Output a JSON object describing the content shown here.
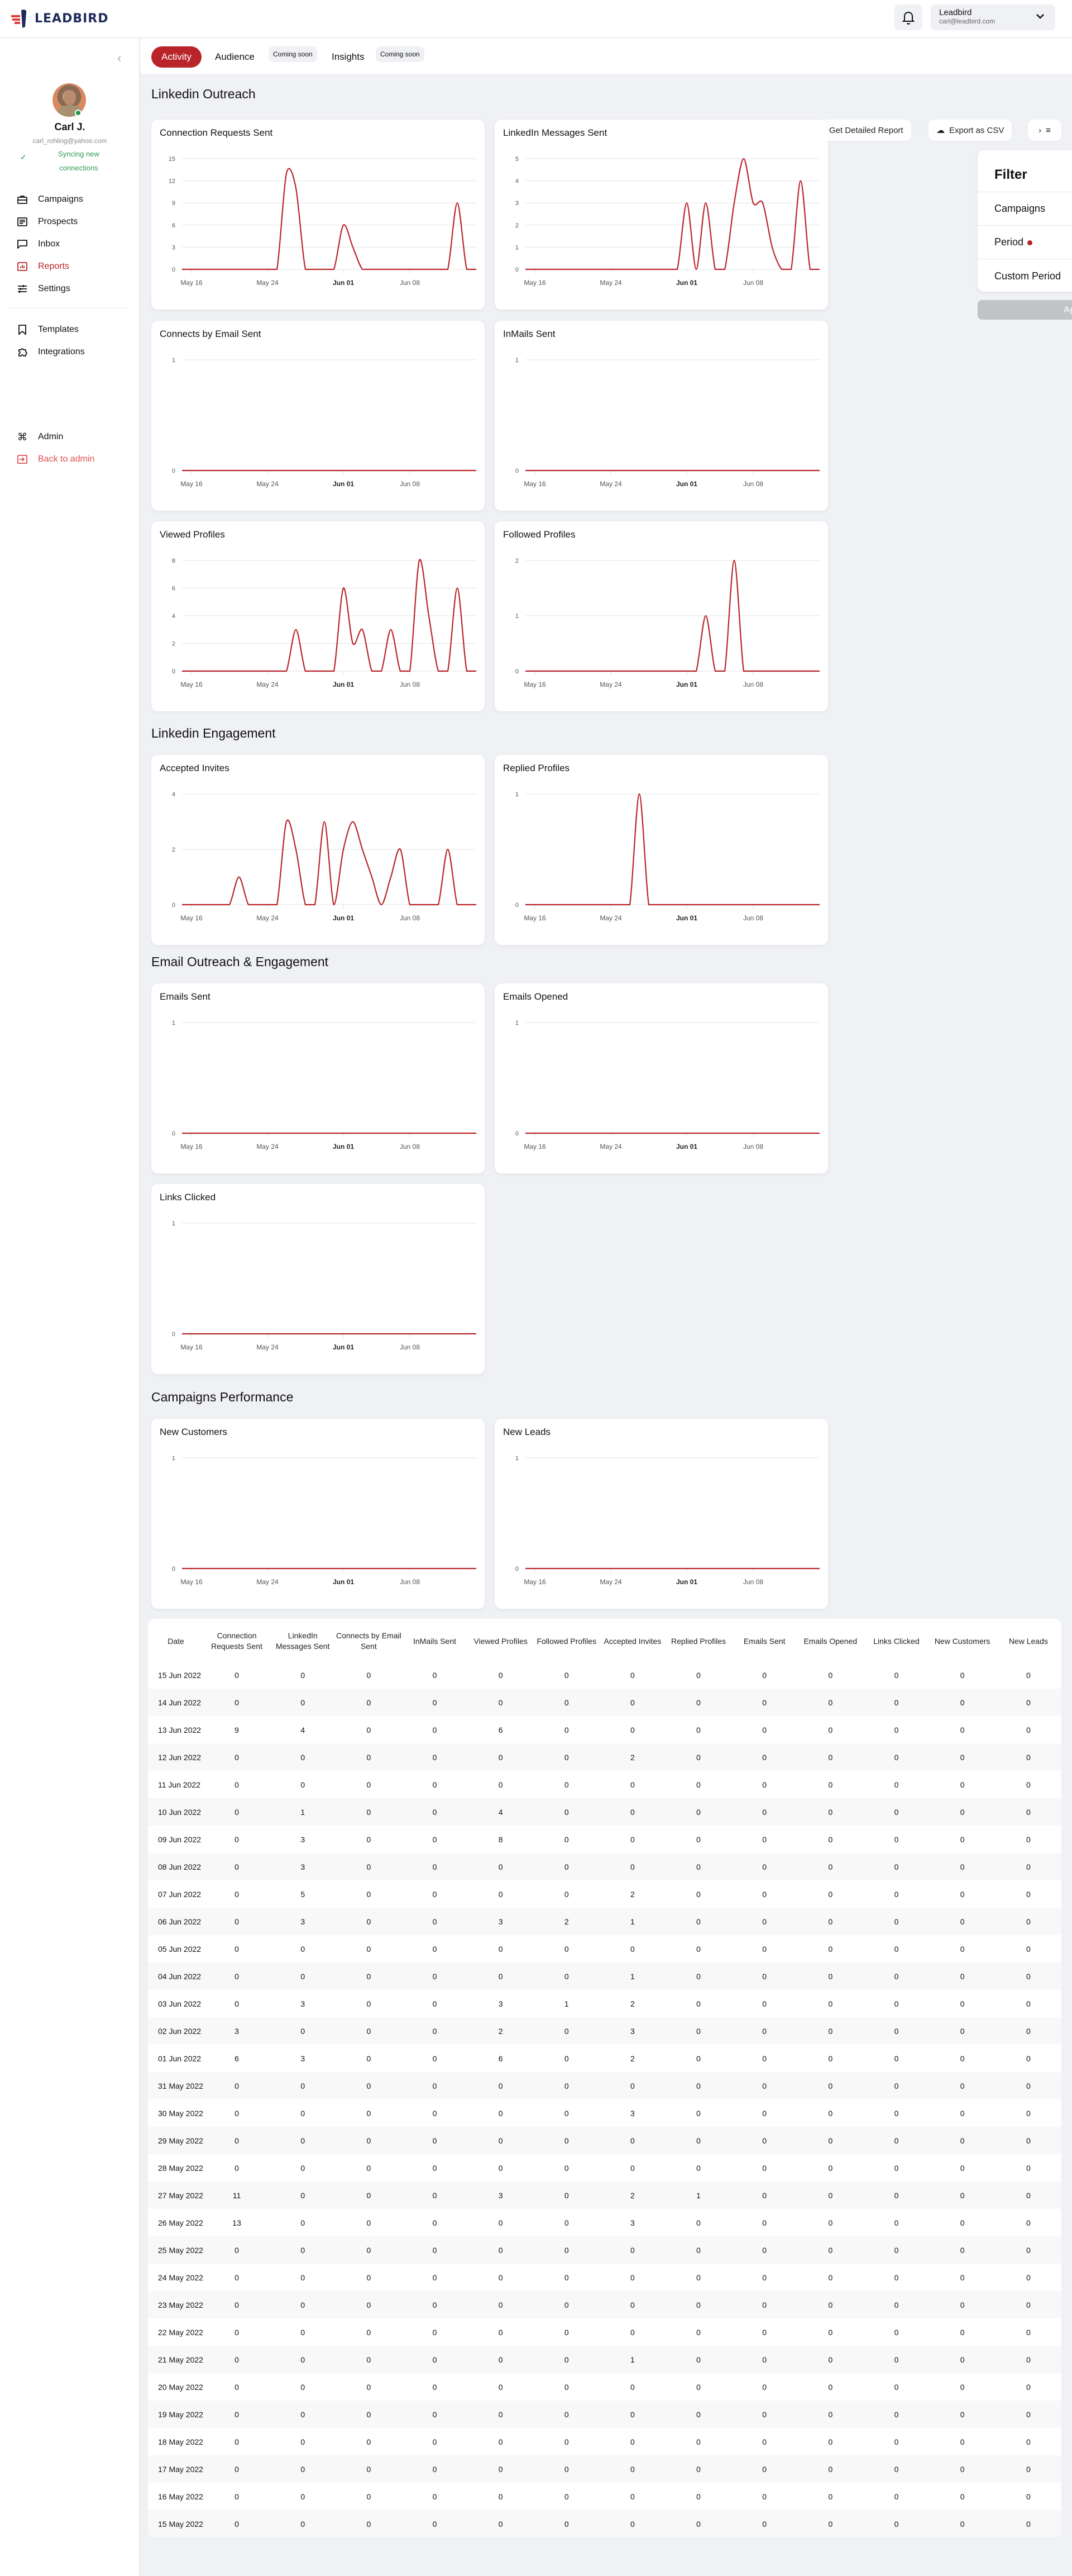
{
  "topbar": {
    "logo_text": "LEADBIRD",
    "account": {
      "name": "Leadbird",
      "email": "carl@leadbird.com"
    }
  },
  "sidebar": {
    "user": {
      "name": "Carl J.",
      "email": "carl_rohling@yahoo.com",
      "sync_status": "Syncing new connections"
    },
    "nav_main": [
      {
        "label": "Campaigns",
        "icon": "briefcase-icon"
      },
      {
        "label": "Prospects",
        "icon": "list-card-icon"
      },
      {
        "label": "Inbox",
        "icon": "chat-bubble-icon"
      },
      {
        "label": "Reports",
        "icon": "bar-chart-icon",
        "active": true
      },
      {
        "label": "Settings",
        "icon": "sliders-icon"
      }
    ],
    "nav_secondary": [
      {
        "label": "Templates",
        "icon": "bookmark-icon"
      },
      {
        "label": "Integrations",
        "icon": "puzzle-icon"
      }
    ],
    "nav_admin": [
      {
        "label": "Admin",
        "icon": "command-icon"
      },
      {
        "label": "Back to admin",
        "icon": "sign-in-icon"
      }
    ]
  },
  "tabs": {
    "activity": "Activity",
    "audience": "Audience",
    "audience_badge": "Coming soon",
    "insights": "Insights",
    "insights_badge": "Coming soon"
  },
  "toolbar": {
    "detailed_report": "Get Detailed Report",
    "export_csv": "Export as CSV",
    "filter_toggle": "›"
  },
  "filter": {
    "title": "Filter",
    "rows": [
      "Campaigns",
      "Period",
      "Custom Period"
    ],
    "apply": "Apply filters"
  },
  "sections": {
    "linkedin_outreach": "Linkedin Outreach",
    "linkedin_engagement": "Linkedin Engagement",
    "email": "Email Outreach & Engagement",
    "campaigns": "Campaigns Performance"
  },
  "colors": {
    "accent": "#b9242a",
    "success": "#1f9a4b",
    "background": "#f0f1f5"
  },
  "chart_data": [
    {
      "type": "line",
      "title": "Connection Requests Sent",
      "x_ticks": [
        "May 16",
        "May 24",
        "Jun 01",
        "Jun 08"
      ],
      "y_ticks": [
        0,
        3,
        6,
        9,
        12,
        15
      ],
      "ylim": [
        0,
        15
      ],
      "x_start": "15 May 2022",
      "values": [
        0,
        0,
        0,
        0,
        0,
        0,
        0,
        0,
        0,
        0,
        0,
        13,
        11,
        0,
        0,
        0,
        0,
        6,
        3,
        0,
        0,
        0,
        0,
        0,
        0,
        0,
        0,
        0,
        0,
        9,
        0,
        0
      ]
    },
    {
      "type": "line",
      "title": "LinkedIn Messages Sent",
      "x_ticks": [
        "May 16",
        "May 24",
        "Jun 01",
        "Jun 08"
      ],
      "y_ticks": [
        0,
        1,
        2,
        3,
        4,
        5
      ],
      "ylim": [
        0,
        5
      ],
      "x_start": "15 May 2022",
      "values": [
        0,
        0,
        0,
        0,
        0,
        0,
        0,
        0,
        0,
        0,
        0,
        0,
        0,
        0,
        0,
        0,
        0,
        3,
        0,
        3,
        0,
        0,
        3,
        5,
        3,
        3,
        1,
        0,
        0,
        4,
        0,
        0
      ]
    },
    {
      "type": "line",
      "title": "Connects by Email Sent",
      "x_ticks": [
        "May 16",
        "May 24",
        "Jun 01",
        "Jun 08"
      ],
      "y_ticks": [
        0,
        1
      ],
      "ylim": [
        0,
        1
      ],
      "x_start": "15 May 2022",
      "values": [
        0,
        0,
        0,
        0,
        0,
        0,
        0,
        0,
        0,
        0,
        0,
        0,
        0,
        0,
        0,
        0,
        0,
        0,
        0,
        0,
        0,
        0,
        0,
        0,
        0,
        0,
        0,
        0,
        0,
        0,
        0,
        0
      ]
    },
    {
      "type": "line",
      "title": "InMails Sent",
      "x_ticks": [
        "May 16",
        "May 24",
        "Jun 01",
        "Jun 08"
      ],
      "y_ticks": [
        0,
        1
      ],
      "ylim": [
        0,
        1
      ],
      "x_start": "15 May 2022",
      "values": [
        0,
        0,
        0,
        0,
        0,
        0,
        0,
        0,
        0,
        0,
        0,
        0,
        0,
        0,
        0,
        0,
        0,
        0,
        0,
        0,
        0,
        0,
        0,
        0,
        0,
        0,
        0,
        0,
        0,
        0,
        0,
        0
      ]
    },
    {
      "type": "line",
      "title": "Viewed Profiles",
      "x_ticks": [
        "May 16",
        "May 24",
        "Jun 01",
        "Jun 08"
      ],
      "y_ticks": [
        0,
        2,
        4,
        6,
        8
      ],
      "ylim": [
        0,
        8
      ],
      "x_start": "15 May 2022",
      "values": [
        0,
        0,
        0,
        0,
        0,
        0,
        0,
        0,
        0,
        0,
        0,
        0,
        3,
        0,
        0,
        0,
        0,
        6,
        2,
        3,
        0,
        0,
        3,
        0,
        0,
        8,
        4,
        0,
        0,
        6,
        0,
        0
      ]
    },
    {
      "type": "line",
      "title": "Followed Profiles",
      "x_ticks": [
        "May 16",
        "May 24",
        "Jun 01",
        "Jun 08"
      ],
      "y_ticks": [
        0,
        1,
        2
      ],
      "ylim": [
        0,
        2
      ],
      "x_start": "15 May 2022",
      "values": [
        0,
        0,
        0,
        0,
        0,
        0,
        0,
        0,
        0,
        0,
        0,
        0,
        0,
        0,
        0,
        0,
        0,
        0,
        0,
        1,
        0,
        0,
        2,
        0,
        0,
        0,
        0,
        0,
        0,
        0,
        0,
        0
      ]
    },
    {
      "type": "line",
      "title": "Accepted Invites",
      "x_ticks": [
        "May 16",
        "May 24",
        "Jun 01",
        "Jun 08"
      ],
      "y_ticks": [
        0,
        2,
        4
      ],
      "ylim": [
        0,
        4
      ],
      "x_start": "15 May 2022",
      "values": [
        0,
        0,
        0,
        0,
        0,
        0,
        1,
        0,
        0,
        0,
        0,
        3,
        2,
        0,
        0,
        3,
        0,
        2,
        3,
        2,
        1,
        0,
        1,
        2,
        0,
        0,
        0,
        0,
        2,
        0,
        0,
        0
      ]
    },
    {
      "type": "line",
      "title": "Replied Profiles",
      "x_ticks": [
        "May 16",
        "May 24",
        "Jun 01",
        "Jun 08"
      ],
      "y_ticks": [
        0,
        1
      ],
      "ylim": [
        0,
        1
      ],
      "x_start": "15 May 2022",
      "values": [
        0,
        0,
        0,
        0,
        0,
        0,
        0,
        0,
        0,
        0,
        0,
        0,
        1,
        0,
        0,
        0,
        0,
        0,
        0,
        0,
        0,
        0,
        0,
        0,
        0,
        0,
        0,
        0,
        0,
        0,
        0,
        0
      ]
    },
    {
      "type": "line",
      "title": "Emails Sent",
      "x_ticks": [
        "May 16",
        "May 24",
        "Jun 01",
        "Jun 08"
      ],
      "y_ticks": [
        0,
        1
      ],
      "ylim": [
        0,
        1
      ],
      "x_start": "15 May 2022",
      "values": [
        0,
        0,
        0,
        0,
        0,
        0,
        0,
        0,
        0,
        0,
        0,
        0,
        0,
        0,
        0,
        0,
        0,
        0,
        0,
        0,
        0,
        0,
        0,
        0,
        0,
        0,
        0,
        0,
        0,
        0,
        0,
        0
      ]
    },
    {
      "type": "line",
      "title": "Emails Opened",
      "x_ticks": [
        "May 16",
        "May 24",
        "Jun 01",
        "Jun 08"
      ],
      "y_ticks": [
        0,
        1
      ],
      "ylim": [
        0,
        1
      ],
      "x_start": "15 May 2022",
      "values": [
        0,
        0,
        0,
        0,
        0,
        0,
        0,
        0,
        0,
        0,
        0,
        0,
        0,
        0,
        0,
        0,
        0,
        0,
        0,
        0,
        0,
        0,
        0,
        0,
        0,
        0,
        0,
        0,
        0,
        0,
        0,
        0
      ]
    },
    {
      "type": "line",
      "title": "Links Clicked",
      "x_ticks": [
        "May 16",
        "May 24",
        "Jun 01",
        "Jun 08"
      ],
      "y_ticks": [
        0,
        1
      ],
      "ylim": [
        0,
        1
      ],
      "x_start": "15 May 2022",
      "values": [
        0,
        0,
        0,
        0,
        0,
        0,
        0,
        0,
        0,
        0,
        0,
        0,
        0,
        0,
        0,
        0,
        0,
        0,
        0,
        0,
        0,
        0,
        0,
        0,
        0,
        0,
        0,
        0,
        0,
        0,
        0,
        0
      ]
    },
    {
      "type": "line",
      "title": "New Customers",
      "x_ticks": [
        "May 16",
        "May 24",
        "Jun 01",
        "Jun 08"
      ],
      "y_ticks": [
        0,
        1
      ],
      "ylim": [
        0,
        1
      ],
      "x_start": "15 May 2022",
      "values": [
        0,
        0,
        0,
        0,
        0,
        0,
        0,
        0,
        0,
        0,
        0,
        0,
        0,
        0,
        0,
        0,
        0,
        0,
        0,
        0,
        0,
        0,
        0,
        0,
        0,
        0,
        0,
        0,
        0,
        0,
        0,
        0
      ]
    },
    {
      "type": "line",
      "title": "New Leads",
      "x_ticks": [
        "May 16",
        "May 24",
        "Jun 01",
        "Jun 08"
      ],
      "y_ticks": [
        0,
        1
      ],
      "ylim": [
        0,
        1
      ],
      "x_start": "15 May 2022",
      "values": [
        0,
        0,
        0,
        0,
        0,
        0,
        0,
        0,
        0,
        0,
        0,
        0,
        0,
        0,
        0,
        0,
        0,
        0,
        0,
        0,
        0,
        0,
        0,
        0,
        0,
        0,
        0,
        0,
        0,
        0,
        0,
        0
      ]
    }
  ],
  "table": {
    "columns": [
      "Date",
      "Connection Requests Sent",
      "LinkedIn Messages Sent",
      "Connects by Email Sent",
      "InMails Sent",
      "Viewed Profiles",
      "Followed Profiles",
      "Accepted Invites",
      "Replied Profiles",
      "Emails Sent",
      "Emails Opened",
      "Links Clicked",
      "New Customers",
      "New Leads"
    ],
    "rows": [
      [
        "15 Jun 2022",
        0,
        0,
        0,
        0,
        0,
        0,
        0,
        0,
        0,
        0,
        0,
        0,
        0
      ],
      [
        "14 Jun 2022",
        0,
        0,
        0,
        0,
        0,
        0,
        0,
        0,
        0,
        0,
        0,
        0,
        0
      ],
      [
        "13 Jun 2022",
        9,
        4,
        0,
        0,
        6,
        0,
        0,
        0,
        0,
        0,
        0,
        0,
        0
      ],
      [
        "12 Jun 2022",
        0,
        0,
        0,
        0,
        0,
        0,
        2,
        0,
        0,
        0,
        0,
        0,
        0
      ],
      [
        "11 Jun 2022",
        0,
        0,
        0,
        0,
        0,
        0,
        0,
        0,
        0,
        0,
        0,
        0,
        0
      ],
      [
        "10 Jun 2022",
        0,
        1,
        0,
        0,
        4,
        0,
        0,
        0,
        0,
        0,
        0,
        0,
        0
      ],
      [
        "09 Jun 2022",
        0,
        3,
        0,
        0,
        8,
        0,
        0,
        0,
        0,
        0,
        0,
        0,
        0
      ],
      [
        "08 Jun 2022",
        0,
        3,
        0,
        0,
        0,
        0,
        0,
        0,
        0,
        0,
        0,
        0,
        0
      ],
      [
        "07 Jun 2022",
        0,
        5,
        0,
        0,
        0,
        0,
        2,
        0,
        0,
        0,
        0,
        0,
        0
      ],
      [
        "06 Jun 2022",
        0,
        3,
        0,
        0,
        3,
        2,
        1,
        0,
        0,
        0,
        0,
        0,
        0
      ],
      [
        "05 Jun 2022",
        0,
        0,
        0,
        0,
        0,
        0,
        0,
        0,
        0,
        0,
        0,
        0,
        0
      ],
      [
        "04 Jun 2022",
        0,
        0,
        0,
        0,
        0,
        0,
        1,
        0,
        0,
        0,
        0,
        0,
        0
      ],
      [
        "03 Jun 2022",
        0,
        3,
        0,
        0,
        3,
        1,
        2,
        0,
        0,
        0,
        0,
        0,
        0
      ],
      [
        "02 Jun 2022",
        3,
        0,
        0,
        0,
        2,
        0,
        3,
        0,
        0,
        0,
        0,
        0,
        0
      ],
      [
        "01 Jun 2022",
        6,
        3,
        0,
        0,
        6,
        0,
        2,
        0,
        0,
        0,
        0,
        0,
        0
      ],
      [
        "31 May 2022",
        0,
        0,
        0,
        0,
        0,
        0,
        0,
        0,
        0,
        0,
        0,
        0,
        0
      ],
      [
        "30 May 2022",
        0,
        0,
        0,
        0,
        0,
        0,
        3,
        0,
        0,
        0,
        0,
        0,
        0
      ],
      [
        "29 May 2022",
        0,
        0,
        0,
        0,
        0,
        0,
        0,
        0,
        0,
        0,
        0,
        0,
        0
      ],
      [
        "28 May 2022",
        0,
        0,
        0,
        0,
        0,
        0,
        0,
        0,
        0,
        0,
        0,
        0,
        0
      ],
      [
        "27 May 2022",
        11,
        0,
        0,
        0,
        3,
        0,
        2,
        1,
        0,
        0,
        0,
        0,
        0
      ],
      [
        "26 May 2022",
        13,
        0,
        0,
        0,
        0,
        0,
        3,
        0,
        0,
        0,
        0,
        0,
        0
      ],
      [
        "25 May 2022",
        0,
        0,
        0,
        0,
        0,
        0,
        0,
        0,
        0,
        0,
        0,
        0,
        0
      ],
      [
        "24 May 2022",
        0,
        0,
        0,
        0,
        0,
        0,
        0,
        0,
        0,
        0,
        0,
        0,
        0
      ],
      [
        "23 May 2022",
        0,
        0,
        0,
        0,
        0,
        0,
        0,
        0,
        0,
        0,
        0,
        0,
        0
      ],
      [
        "22 May 2022",
        0,
        0,
        0,
        0,
        0,
        0,
        0,
        0,
        0,
        0,
        0,
        0,
        0
      ],
      [
        "21 May 2022",
        0,
        0,
        0,
        0,
        0,
        0,
        1,
        0,
        0,
        0,
        0,
        0,
        0
      ],
      [
        "20 May 2022",
        0,
        0,
        0,
        0,
        0,
        0,
        0,
        0,
        0,
        0,
        0,
        0,
        0
      ],
      [
        "19 May 2022",
        0,
        0,
        0,
        0,
        0,
        0,
        0,
        0,
        0,
        0,
        0,
        0,
        0
      ],
      [
        "18 May 2022",
        0,
        0,
        0,
        0,
        0,
        0,
        0,
        0,
        0,
        0,
        0,
        0,
        0
      ],
      [
        "17 May 2022",
        0,
        0,
        0,
        0,
        0,
        0,
        0,
        0,
        0,
        0,
        0,
        0,
        0
      ],
      [
        "16 May 2022",
        0,
        0,
        0,
        0,
        0,
        0,
        0,
        0,
        0,
        0,
        0,
        0,
        0
      ],
      [
        "15 May 2022",
        0,
        0,
        0,
        0,
        0,
        0,
        0,
        0,
        0,
        0,
        0,
        0,
        0
      ]
    ]
  }
}
